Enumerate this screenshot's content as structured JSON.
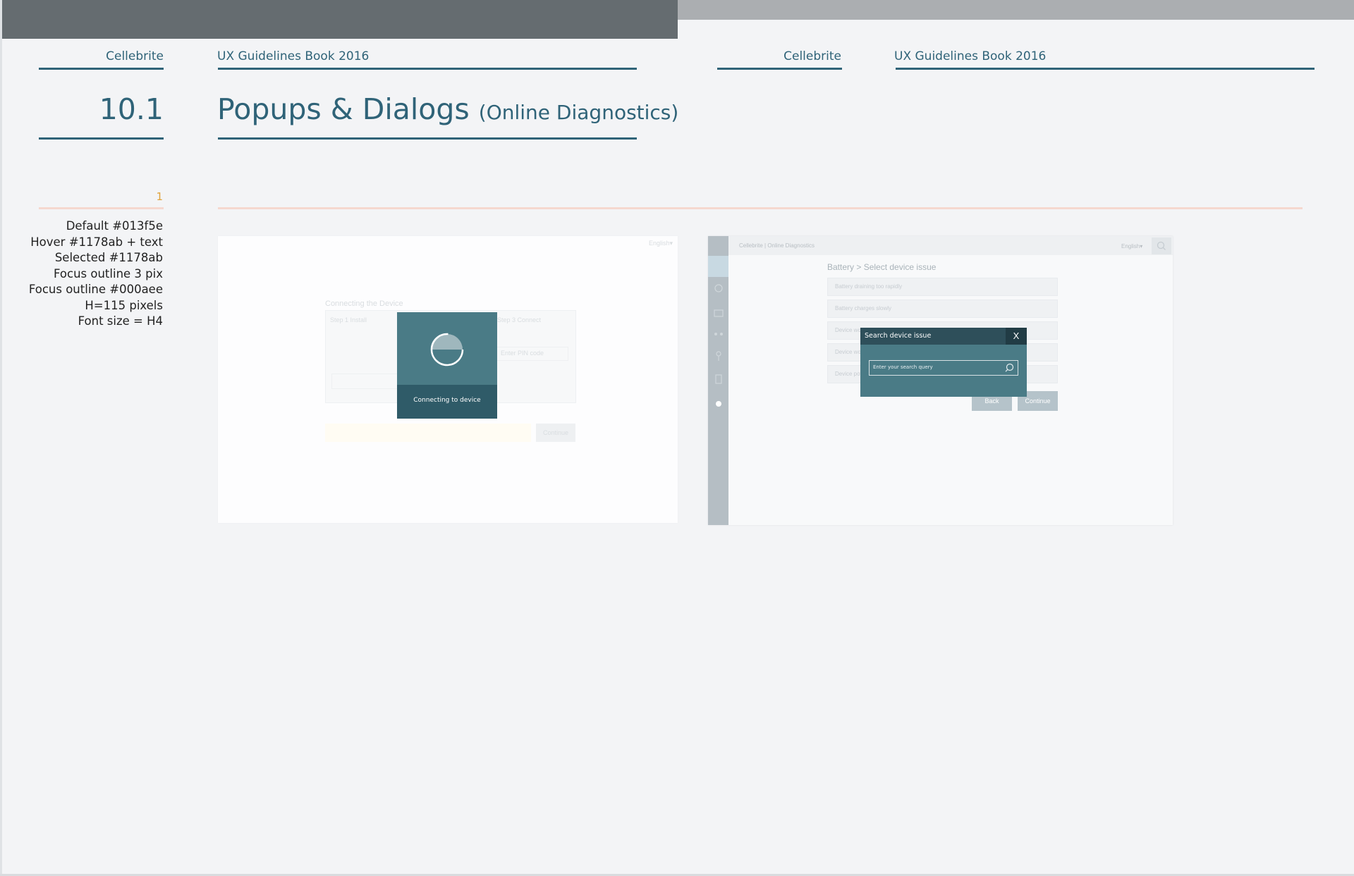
{
  "header": {
    "brand": "Cellebrite",
    "book": "UX Guidelines Book 2016"
  },
  "section": {
    "number": "10.1",
    "title": "Popups & Dialogs",
    "subtitle": "(Online Diagnostics)"
  },
  "item_number": "1",
  "notes": [
    "Default #013f5e",
    "Hover #1178ab + text",
    "Selected #1178ab",
    "Focus outline 3 pix",
    "Focus outline #000aee",
    "H=115 pixels",
    "Font size = H4"
  ],
  "screenshot1": {
    "lang": "English▾",
    "heading": "Connecting the Device",
    "step1": "Step 1 Install",
    "step3": "Step 3 Connect",
    "step3_input": "Enter PIN code",
    "continue_label": "Continue",
    "loader_label": "Connecting to device"
  },
  "screenshot2": {
    "brand": "Cellebrite | Online Diagnostics",
    "lang": "English▾",
    "breadcrumb": "Battery > Select device issue",
    "rows": [
      "Battery draining too rapidly",
      "Battery charges slowly",
      "Device wo",
      "Device wo",
      "Device pow"
    ],
    "back_label": "Back",
    "continue_label": "Continue",
    "dialog_title": "Search device issue",
    "dialog_close": "X",
    "search_placeholder": "Enter your search query"
  },
  "colors": {
    "primary_text": "#2f6378",
    "accent_number": "#e0a33a",
    "loader_bg": "#4a7b86",
    "dialog_head": "#2e4f5a"
  }
}
